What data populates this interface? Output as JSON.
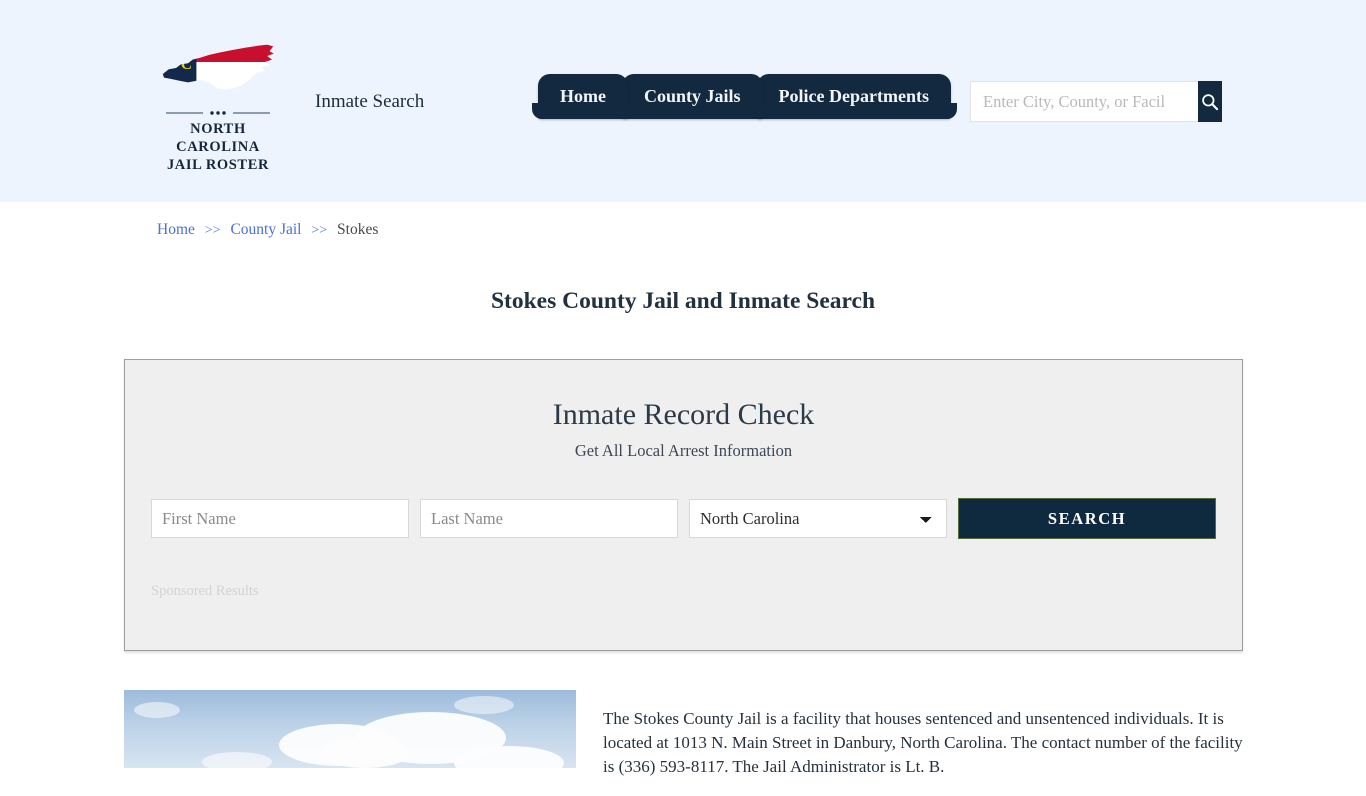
{
  "header": {
    "logo": {
      "name": "north-carolina-jail-roster-logo",
      "line1": "NORTH CAROLINA",
      "line2": "JAIL ROSTER",
      "map_alt": "North Carolina state outline filled with state flag"
    },
    "tagline": "Inmate Search",
    "nav": [
      {
        "label": "Home",
        "name": "nav-tab-home"
      },
      {
        "label": "County Jails",
        "name": "nav-tab-county-jails"
      },
      {
        "label": "Police Departments",
        "name": "nav-tab-police-departments"
      }
    ],
    "search": {
      "placeholder": "Enter City, County, or Facil",
      "value": "",
      "icon": "search-icon"
    },
    "background_color": "#eef4fd"
  },
  "breadcrumb": {
    "items": [
      {
        "label": "Home",
        "link": true
      },
      {
        "label": "County Jail",
        "link": true
      },
      {
        "label": "Stokes",
        "link": false
      }
    ],
    "separator": ">>"
  },
  "page": {
    "title": "Stokes County Jail and Inmate Search"
  },
  "record_check": {
    "heading": "Inmate Record Check",
    "subheading": "Get All Local Arrest Information",
    "form": {
      "first_name": {
        "placeholder": "First Name",
        "value": ""
      },
      "last_name": {
        "placeholder": "Last Name",
        "value": ""
      },
      "state": {
        "selected": "North Carolina",
        "options": [
          "North Carolina"
        ],
        "icon": "chevron-down-icon"
      },
      "submit_label": "SEARCH"
    },
    "sponsored_label": "Sponsored Results",
    "panel_background": "#efefef",
    "accent_color": "#0f2a3e"
  },
  "content": {
    "photo_alt": "Sky with clouds above the Stokes County Jail",
    "description": "The Stokes County Jail is a facility that houses sentenced and unsentenced individuals. It is located at 1013 N. Main Street in Danbury, North Carolina. The contact number of the facility is (336) 593-8117. The Jail Administrator is Lt. B."
  }
}
